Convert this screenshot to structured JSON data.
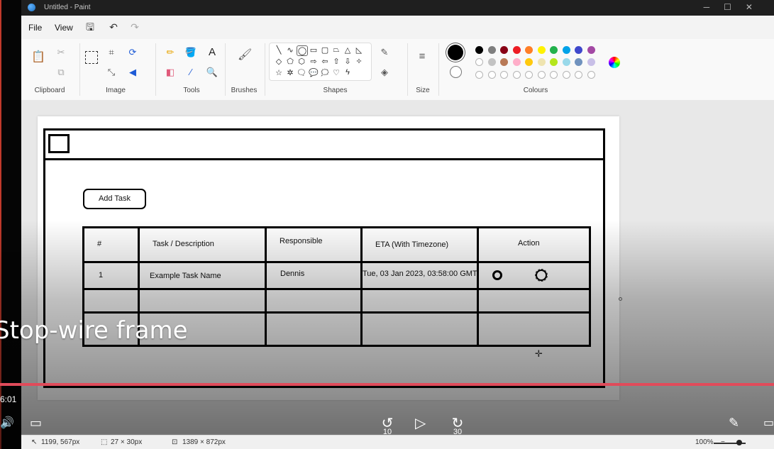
{
  "window": {
    "title": "Untitled - Paint"
  },
  "menu": {
    "file": "File",
    "view": "View"
  },
  "ribbon": {
    "groups": {
      "clipboard": "Clipboard",
      "image": "Image",
      "tools": "Tools",
      "brushes": "Brushes",
      "shapes": "Shapes",
      "size": "Size",
      "colours": "Colours"
    },
    "palette_row1": [
      "#000000",
      "#7f7f7f",
      "#880015",
      "#ed1c24",
      "#ff7f27",
      "#fff200",
      "#22b14c",
      "#00a2e8",
      "#3f48cc",
      "#a349a4"
    ],
    "palette_row2": [
      "#ffffff",
      "#c3c3c3",
      "#b97a57",
      "#ffaec9",
      "#ffc90e",
      "#efe4b0",
      "#b5e61d",
      "#99d9ea",
      "#7092be",
      "#c8bfe7"
    ],
    "primary_color": "#000000",
    "secondary_color": "#ffffff"
  },
  "wireframe": {
    "add_task": "Add Task",
    "headers": [
      "#",
      "Task / Description",
      "Responsible",
      "ETA (With Timezone)",
      "Action"
    ],
    "row1": [
      "1",
      "Example Task Name",
      "Dennis",
      "Tue, 03 Jan 2023, 03:58:00 GMT"
    ]
  },
  "video": {
    "caption": "Stop-wire frame",
    "time": "6:01",
    "rewind": "10",
    "forward": "30"
  },
  "status": {
    "cursor": "1199, 567px",
    "selection": "27 × 30px",
    "canvas_size": "1389 × 872px",
    "zoom": "100%"
  }
}
